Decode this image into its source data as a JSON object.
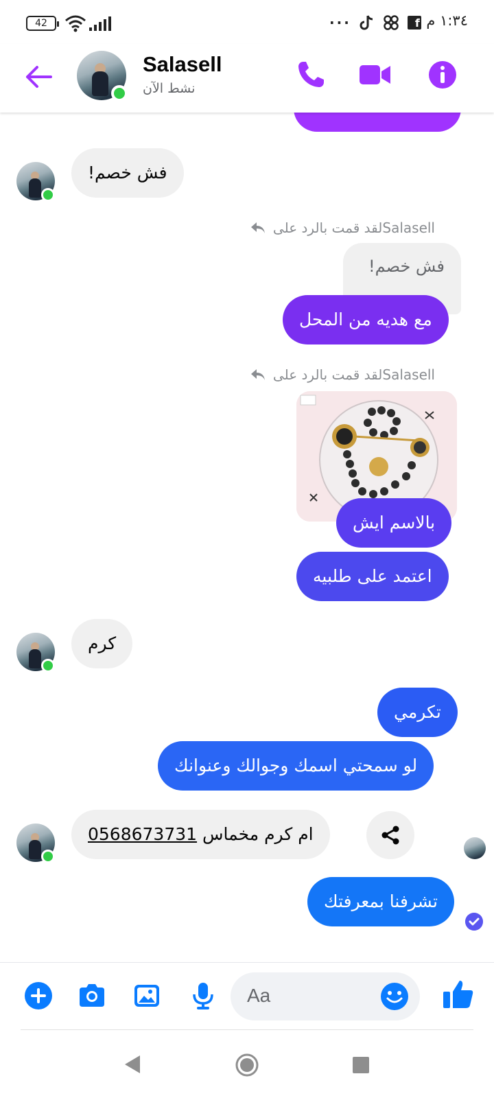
{
  "status_bar": {
    "time": "١:٣٤ م",
    "battery": "42",
    "dots": "···",
    "fb_glyph": "f"
  },
  "header": {
    "contact_name": "Salasell",
    "status": "نشط الآن"
  },
  "messages": {
    "top_partial": "",
    "m1": "فش خصم!",
    "reply_note_1_name": "Salasell",
    "reply_note_1_text": "لقد قمت بالرد على",
    "quoted_1": "فش خصم!",
    "m2": "مع هديه من المحل",
    "reply_note_2_name": "Salasell",
    "reply_note_2_text": "لقد قمت بالرد على",
    "m3": "بالاسم ايش",
    "m4": "اعتمد على طلبيه",
    "m5": "كرم",
    "m6": "تكرمي",
    "m7": "لو سمحتي اسمك وجوالك وعنوانك",
    "m8_name": "ام كرم مخماس",
    "m8_phone": "0568673731",
    "m9": "تشرفنا بمعرفتك"
  },
  "composer": {
    "placeholder": "Aa"
  },
  "colors": {
    "accent_purple": "#a033ff",
    "bubble_violet": "#7a2ff0",
    "bubble_indigo": "#4c49ee",
    "bubble_blue": "#2f5cf5",
    "bubble_azure": "#1476f7",
    "messenger_blue": "#0a7cff",
    "incoming_bg": "#f0f0f0",
    "online_green": "#31cc46"
  }
}
